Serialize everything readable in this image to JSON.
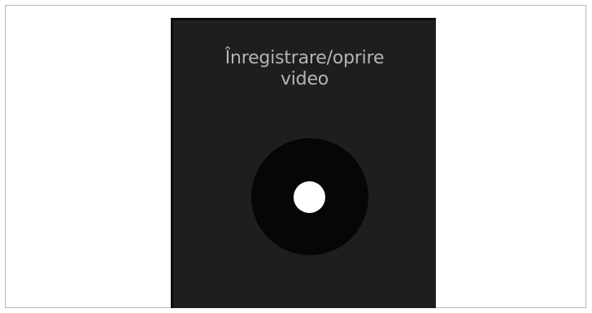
{
  "screen": {
    "title": "Înregistrare/oprire\nvideo"
  },
  "record_button": {
    "label": "Înregistrare/oprire video",
    "icon": "record-dot-icon"
  },
  "colors": {
    "screen_background": "#1e1e1e",
    "button_background": "#060606",
    "record_dot": "#ffffff",
    "title_text": "#b4b4b4"
  }
}
